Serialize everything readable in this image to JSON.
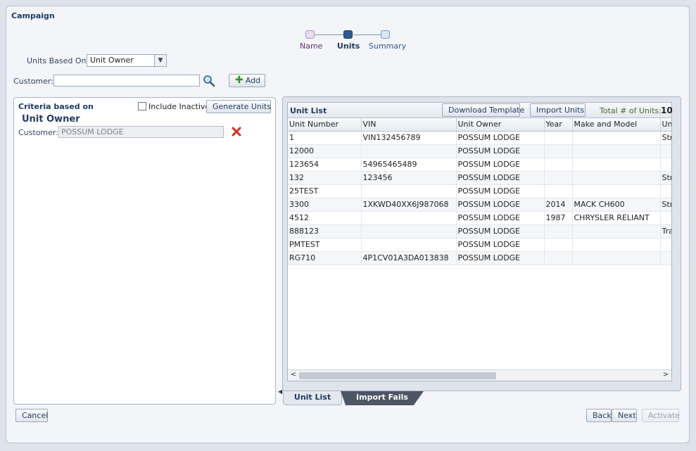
{
  "page_title": "Campaign",
  "train": {
    "steps": [
      {
        "label": "Name",
        "color": "#6a2c7a"
      },
      {
        "label": "Units",
        "color": "#1f3a5f"
      },
      {
        "label": "Summary",
        "color": "#2a5a9a"
      }
    ]
  },
  "form": {
    "units_based_on_label": "Units Based On:",
    "units_based_on_value": "Unit Owner",
    "customer_label": "Customer:",
    "customer_value": "",
    "add_label": "Add"
  },
  "criteria": {
    "title": "Criteria based on",
    "include_inactive_label": "Include Inactive",
    "include_inactive_checked": false,
    "generate_label": "Generate Units",
    "heading": "Unit Owner",
    "customer_label": "Customer:",
    "customer_value": "POSSUM LODGE"
  },
  "unit_list": {
    "title": "Unit List",
    "download_label": "Download Template",
    "import_label": "Import Units",
    "total_label": "Total # of Units:",
    "total_value": "10",
    "columns": [
      "Unit Number",
      "VIN",
      "Unit Owner",
      "Year",
      "Make and Model",
      "Un"
    ],
    "rows": [
      [
        "1",
        "VIN132456789",
        "POSSUM LODGE",
        "",
        "",
        "Str"
      ],
      [
        "12000",
        "",
        "POSSUM LODGE",
        "",
        "",
        ""
      ],
      [
        "123654",
        "54965465489",
        "POSSUM LODGE",
        "",
        "",
        ""
      ],
      [
        "132",
        "123456",
        "POSSUM LODGE",
        "",
        "",
        "Str"
      ],
      [
        "25TEST",
        "",
        "POSSUM LODGE",
        "",
        "",
        ""
      ],
      [
        "3300",
        "1XKWD40XX6J987068",
        "POSSUM LODGE",
        "2014",
        "MACK CH600",
        "Str"
      ],
      [
        "4512",
        "",
        "POSSUM LODGE",
        "1987",
        "CHRYSLER RELIANT",
        ""
      ],
      [
        "888123",
        "",
        "POSSUM LODGE",
        "",
        "",
        "Tra"
      ],
      [
        "PMTEST",
        "",
        "POSSUM LODGE",
        "",
        "",
        ""
      ],
      [
        "RG710",
        "4P1CV01A3DA013838",
        "POSSUM LODGE",
        "",
        "",
        ""
      ]
    ]
  },
  "tabs": {
    "active": "Unit List",
    "inactive": "Import Fails"
  },
  "footer": {
    "cancel": "Cancel",
    "back": "Back",
    "next": "Next",
    "activate": "Activate"
  }
}
